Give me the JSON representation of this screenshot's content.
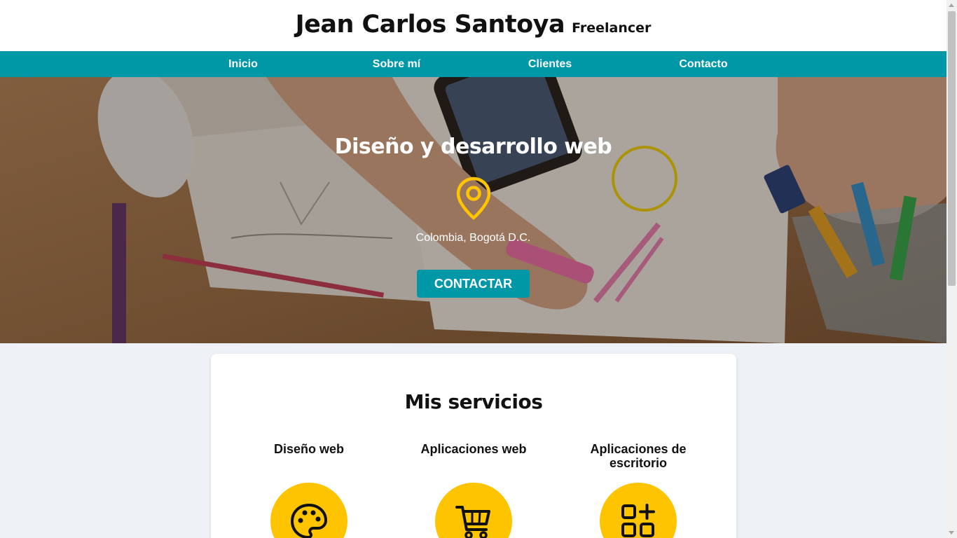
{
  "header": {
    "name": "Jean Carlos Santoya",
    "role": "Freelancer"
  },
  "nav": {
    "items": [
      {
        "label": "Inicio"
      },
      {
        "label": "Sobre mí"
      },
      {
        "label": "Clientes"
      },
      {
        "label": "Contacto"
      }
    ]
  },
  "hero": {
    "title": "Diseño y desarrollo web",
    "location": "Colombia, Bogotá D.C.",
    "button_label": "CONTACTAR",
    "icon": "location-pin-icon"
  },
  "services": {
    "title": "Mis servicios",
    "items": [
      {
        "name": "Diseño web",
        "icon": "palette-icon"
      },
      {
        "name": "Aplicaciones web",
        "icon": "shopping-cart-icon"
      },
      {
        "name": "Aplicaciones de escritorio",
        "icon": "apps-grid-icon"
      }
    ]
  },
  "colors": {
    "accent": "#0097a7",
    "highlight": "#ffc400",
    "background": "#eef2f7"
  }
}
